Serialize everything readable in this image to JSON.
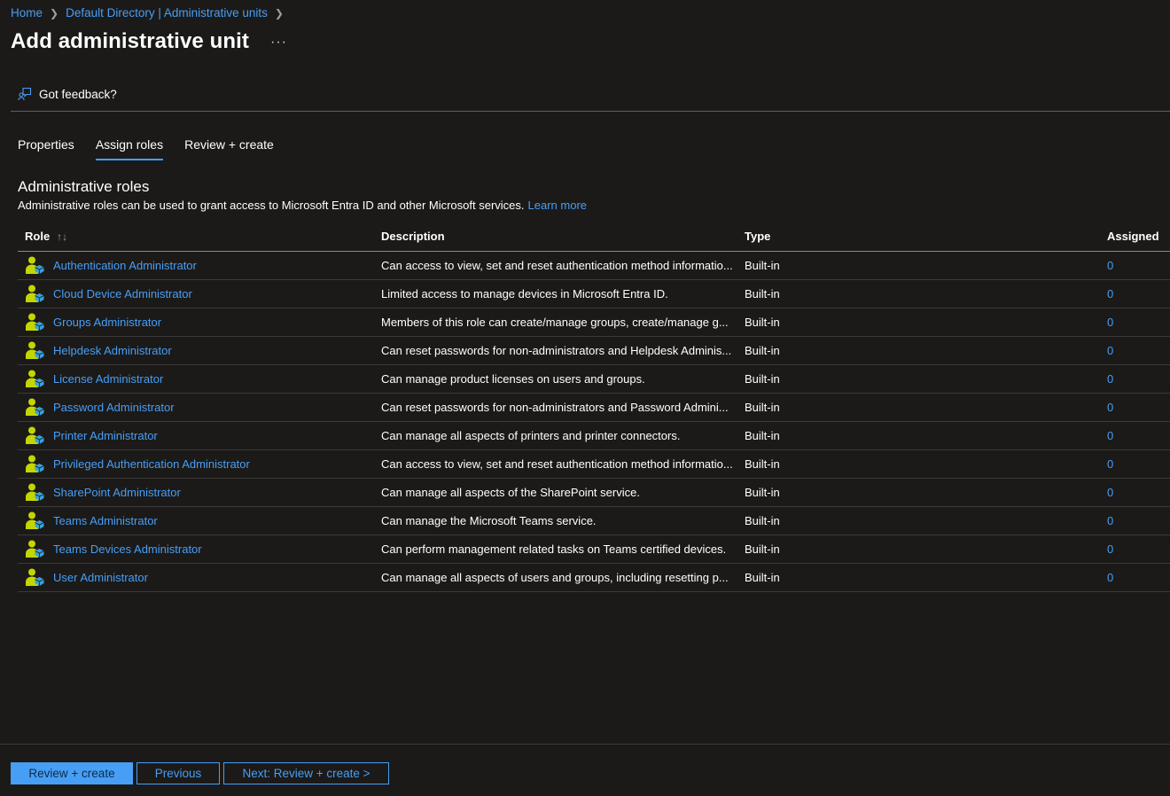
{
  "breadcrumb": {
    "home": "Home",
    "directory": "Default Directory | Administrative units"
  },
  "header": {
    "title": "Add administrative unit",
    "more": "···"
  },
  "toolbar": {
    "feedback": "Got feedback?"
  },
  "tabs": [
    {
      "label": "Properties",
      "active": false
    },
    {
      "label": "Assign roles",
      "active": true
    },
    {
      "label": "Review + create",
      "active": false
    }
  ],
  "section": {
    "title": "Administrative roles",
    "description": "Administrative roles can be used to grant access to Microsoft Entra ID and other Microsoft services.",
    "learn_more": "Learn more"
  },
  "table": {
    "headers": {
      "role": "Role",
      "sort": "↑↓",
      "description": "Description",
      "type": "Type",
      "assigned": "Assigned"
    },
    "rows": [
      {
        "role": "Authentication Administrator",
        "description": "Can access to view, set and reset authentication method informatio...",
        "type": "Built-in",
        "assigned": "0"
      },
      {
        "role": "Cloud Device Administrator",
        "description": "Limited access to manage devices in Microsoft Entra ID.",
        "type": "Built-in",
        "assigned": "0"
      },
      {
        "role": "Groups Administrator",
        "description": "Members of this role can create/manage groups, create/manage g...",
        "type": "Built-in",
        "assigned": "0"
      },
      {
        "role": "Helpdesk Administrator",
        "description": "Can reset passwords for non-administrators and Helpdesk Adminis...",
        "type": "Built-in",
        "assigned": "0"
      },
      {
        "role": "License Administrator",
        "description": "Can manage product licenses on users and groups.",
        "type": "Built-in",
        "assigned": "0"
      },
      {
        "role": "Password Administrator",
        "description": "Can reset passwords for non-administrators and Password Admini...",
        "type": "Built-in",
        "assigned": "0"
      },
      {
        "role": "Printer Administrator",
        "description": "Can manage all aspects of printers and printer connectors.",
        "type": "Built-in",
        "assigned": "0"
      },
      {
        "role": "Privileged Authentication Administrator",
        "description": "Can access to view, set and reset authentication method informatio...",
        "type": "Built-in",
        "assigned": "0"
      },
      {
        "role": "SharePoint Administrator",
        "description": "Can manage all aspects of the SharePoint service.",
        "type": "Built-in",
        "assigned": "0"
      },
      {
        "role": "Teams Administrator",
        "description": "Can manage the Microsoft Teams service.",
        "type": "Built-in",
        "assigned": "0"
      },
      {
        "role": "Teams Devices Administrator",
        "description": "Can perform management related tasks on Teams certified devices.",
        "type": "Built-in",
        "assigned": "0"
      },
      {
        "role": "User Administrator",
        "description": "Can manage all aspects of users and groups, including resetting p...",
        "type": "Built-in",
        "assigned": "0"
      }
    ]
  },
  "footer": {
    "review_create": "Review + create",
    "previous": "Previous",
    "next": "Next: Review + create >"
  },
  "colors": {
    "background": "#1b1a19",
    "link": "#479ef5",
    "role_icon_green": "#c4d600",
    "role_icon_blue": "#3aa0d8"
  }
}
